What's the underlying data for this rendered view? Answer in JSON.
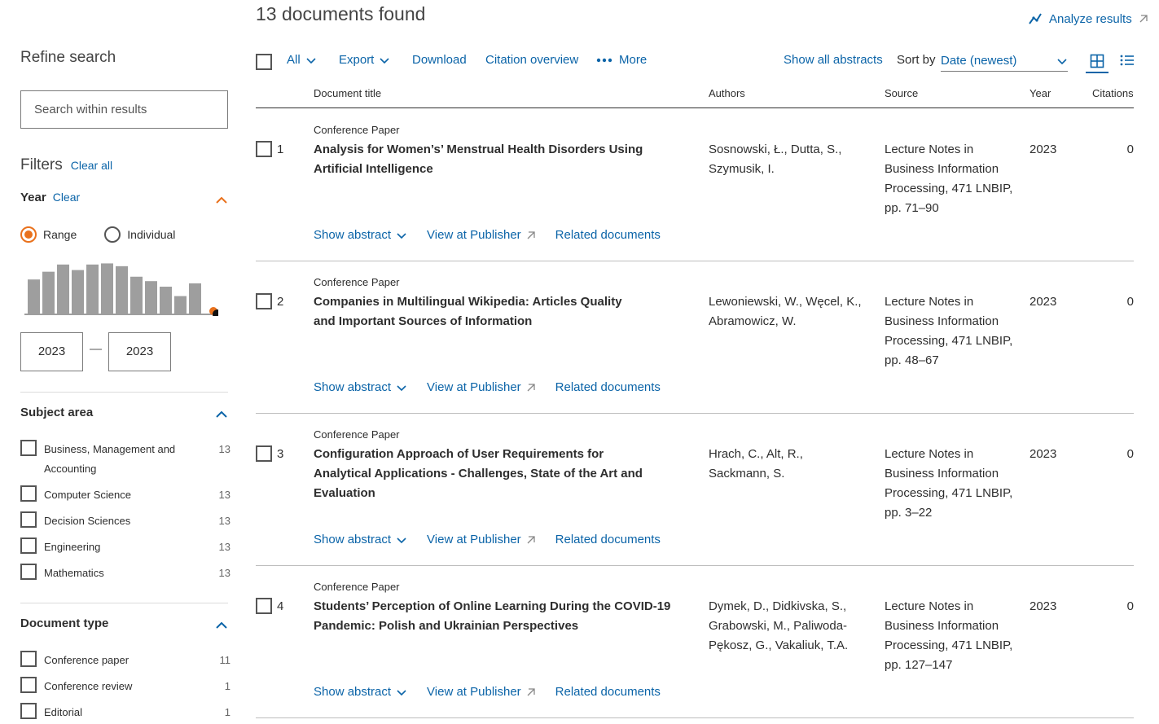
{
  "header": {
    "results_count": "13 documents found",
    "analyze_label": "Analyze results"
  },
  "sidebar": {
    "refine_title": "Refine search",
    "search_placeholder": "Search within results",
    "filters_title": "Filters",
    "clear_all": "Clear all",
    "year": {
      "title": "Year",
      "clear": "Clear",
      "range_label": "Range",
      "individual_label": "Individual",
      "selected_mode": "Range",
      "histogram_levels": [
        0.63,
        0.77,
        0.9,
        0.8,
        0.9,
        0.92,
        0.87,
        0.68,
        0.6,
        0.5,
        0.33,
        0.56
      ],
      "from": "2023",
      "to": "2023",
      "dash": "—"
    },
    "subject_area": {
      "title": "Subject area",
      "items": [
        {
          "label": "Business, Management and Accounting",
          "count": "13"
        },
        {
          "label": "Computer Science",
          "count": "13"
        },
        {
          "label": "Decision Sciences",
          "count": "13"
        },
        {
          "label": "Engineering",
          "count": "13"
        },
        {
          "label": "Mathematics",
          "count": "13"
        }
      ]
    },
    "document_type": {
      "title": "Document type",
      "items": [
        {
          "label": "Conference paper",
          "count": "11"
        },
        {
          "label": "Conference review",
          "count": "1"
        },
        {
          "label": "Editorial",
          "count": "1"
        }
      ]
    }
  },
  "toolbar": {
    "all": "All",
    "export": "Export",
    "download": "Download",
    "citation_overview": "Citation overview",
    "more": "More",
    "show_all_abstracts": "Show all abstracts",
    "sort_by": "Sort by",
    "sort_value": "Date (newest)"
  },
  "columns": {
    "title": "Document title",
    "authors": "Authors",
    "source": "Source",
    "year": "Year",
    "citations": "Citations"
  },
  "results": [
    {
      "num": "1",
      "type": "Conference Paper",
      "title": "Analysis for Women’s’ Menstrual Health Disorders Using Artificial Intelligence",
      "authors": "Sosnowski, Ł., Dutta, S., Szymusik, I.",
      "source": "Lecture Notes in Business Information Processing, 471 LNBIP, pp. 71–90",
      "year": "2023",
      "citations": "0"
    },
    {
      "num": "2",
      "type": "Conference Paper",
      "title": "Companies in Multilingual Wikipedia: Articles Quality and Important Sources of Information",
      "authors": "Lewoniewski, W., Węcel, K., Abramowicz, W.",
      "source": "Lecture Notes in Business Information Processing, 471 LNBIP, pp. 48–67",
      "year": "2023",
      "citations": "0"
    },
    {
      "num": "3",
      "type": "Conference Paper",
      "title": "Configuration Approach of User Requirements for Analytical Applications - Challenges, State of the Art and Evaluation",
      "authors": "Hrach, C., Alt, R., Sackmann, S.",
      "source": "Lecture Notes in Business Information Processing, 471 LNBIP, pp. 3–22",
      "year": "2023",
      "citations": "0"
    },
    {
      "num": "4",
      "type": "Conference Paper",
      "title": "Students’ Perception of Online Learning During the COVID-19 Pandemic: Polish and Ukrainian Perspectives",
      "authors": "Dymek, D., Didkivska, S., Grabowski, M., Paliwoda-Pękosz, G., Vakaliuk, T.A.",
      "source": "Lecture Notes in Business Information Processing, 471 LNBIP, pp. 127–147",
      "year": "2023",
      "citations": "0"
    }
  ],
  "row_actions": {
    "show_abstract": "Show abstract",
    "view_at_publisher": "View at Publisher",
    "related_documents": "Related documents"
  },
  "colors": {
    "link": "#0b64a8",
    "accent": "#e9711c",
    "histogram_bar": "#9e9e9e"
  }
}
